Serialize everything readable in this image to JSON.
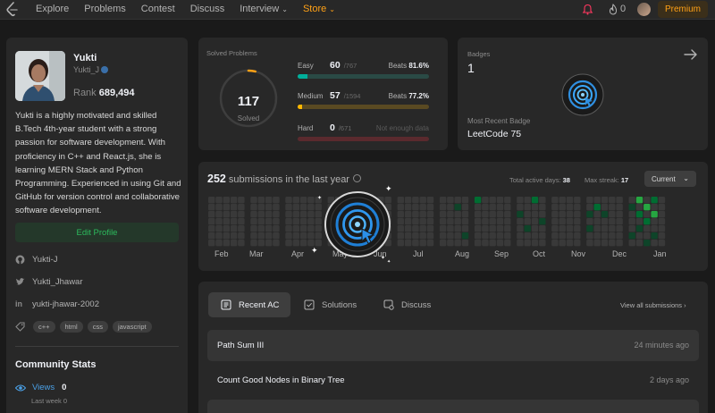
{
  "nav": {
    "links": [
      {
        "label": "Explore"
      },
      {
        "label": "Problems"
      },
      {
        "label": "Contest"
      },
      {
        "label": "Discuss"
      },
      {
        "label": "Interview"
      },
      {
        "label": "Store"
      }
    ],
    "fire_count": "0",
    "premium_label": "Premium"
  },
  "profile": {
    "name": "Yukti",
    "handle": "Yukti_J",
    "rank_label": "Rank",
    "rank_value": "689,494",
    "bio": "Yukti is a highly motivated and skilled B.Tech 4th-year student with a strong passion for software development. With proficiency in C++ and React.js, she is learning MERN Stack and Python Programming. Experienced in using Git and GitHub for version control and collaborative software development.",
    "edit_label": "Edit Profile",
    "github": "Yukti-J",
    "twitter": "Yukti_Jhawar",
    "linkedin": "yukti-jhawar-2002",
    "skills": [
      "c++",
      "html",
      "css",
      "javascript"
    ],
    "community_title": "Community Stats",
    "views_label": "Views",
    "views_value": "0",
    "last_week_label": "Last week",
    "last_week_value": "0"
  },
  "solved": {
    "label": "Solved Problems",
    "total": "117",
    "sub": "Solved",
    "total_fraction": 0.04,
    "difficulties": [
      {
        "name": "Easy",
        "count": "60",
        "total": "/767",
        "beats_label": "Beats",
        "beats": "81.6%",
        "fraction": 0.078,
        "color": "#00af9b",
        "track": "#2a4a45"
      },
      {
        "name": "Medium",
        "count": "57",
        "total": "/1594",
        "beats_label": "Beats",
        "beats": "77.2%",
        "fraction": 0.036,
        "color": "#ffb800",
        "track": "#5a4a22"
      },
      {
        "name": "Hard",
        "count": "0",
        "total": "/671",
        "beats_label": "",
        "beats": "Not enough data",
        "fraction": 0,
        "color": "#ff375f",
        "track": "#5a2a2e"
      }
    ]
  },
  "badges": {
    "label": "Badges",
    "count": "1",
    "recent_label": "Most Recent Badge",
    "recent_name": "LeetCode 75"
  },
  "calendar": {
    "count": "252",
    "title": "submissions in the last year",
    "active_label": "Total active days:",
    "active_value": "38",
    "streak_label": "Max streak:",
    "streak_value": "17",
    "period": "Current",
    "months": [
      "Feb",
      "Mar",
      "Apr",
      "May",
      "Jun",
      "Jul",
      "Aug",
      "Sep",
      "Oct",
      "Nov",
      "Dec",
      "Jan"
    ]
  },
  "recent": {
    "tabs": [
      {
        "label": "Recent AC",
        "icon": "list-icon"
      },
      {
        "label": "Solutions",
        "icon": "checkbox-icon"
      },
      {
        "label": "Discuss",
        "icon": "discuss-icon"
      }
    ],
    "view_all": "View all submissions",
    "items": [
      {
        "title": "Path Sum III",
        "time": "24 minutes ago"
      },
      {
        "title": "Count Good Nodes in Binary Tree",
        "time": "2 days ago"
      }
    ]
  },
  "colors": {
    "accent": "#ffa116",
    "green": "#2cbb5d",
    "bg": "#1a1a1a",
    "card": "#282828"
  }
}
